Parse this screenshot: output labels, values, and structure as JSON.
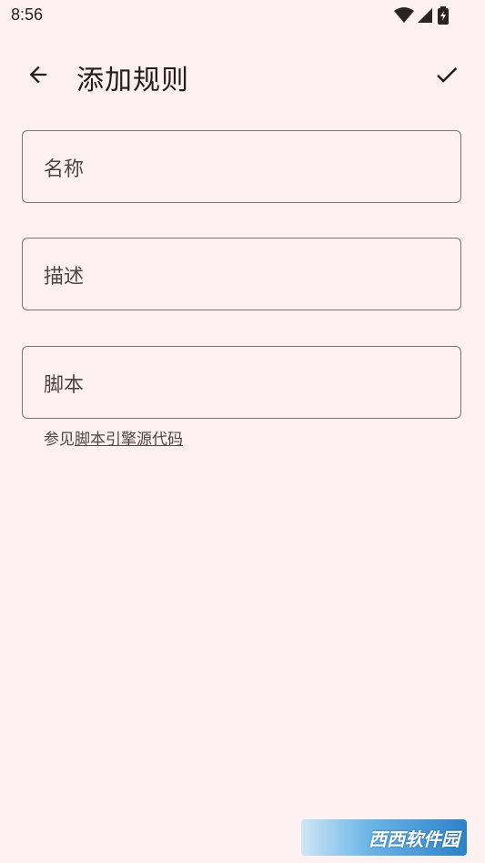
{
  "status_bar": {
    "time": "8:56"
  },
  "app_bar": {
    "title": "添加规则"
  },
  "form": {
    "name_placeholder": "名称",
    "description_placeholder": "描述",
    "script_placeholder": "脚本"
  },
  "helper": {
    "prefix": "参见",
    "link_text": "脚本引擎源代码"
  },
  "watermark": {
    "text": "西西软件园"
  }
}
